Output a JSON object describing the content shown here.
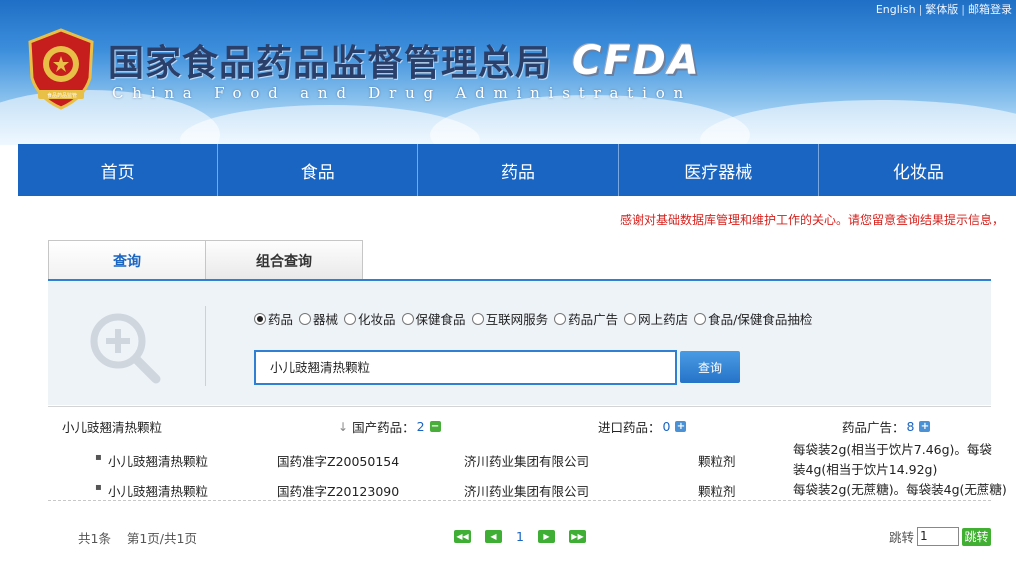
{
  "header": {
    "links": [
      "English",
      "繁体版",
      "邮箱登录"
    ],
    "title_cn": "国家食品药品监督管理总局",
    "title_en": "China Food and Drug Administration",
    "logo_text": "CFDA",
    "emblem_text": "食品药品监管"
  },
  "nav": [
    "首页",
    "食品",
    "药品",
    "医疗器械",
    "化妆品"
  ],
  "notice": "感谢对基础数据库管理和维护工作的关心。请您留意查询结果提示信息，",
  "tabs": [
    "查询",
    "组合查询"
  ],
  "search": {
    "options": [
      "药品",
      "器械",
      "化妆品",
      "保健食品",
      "互联网服务",
      "药品广告",
      "网上药店",
      "食品/保健食品抽检"
    ],
    "selected": "药品",
    "query": "小儿豉翘清热颗粒",
    "button": "查询"
  },
  "summary": {
    "query": "小儿豉翘清热颗粒",
    "domestic_label": "国产药品：",
    "domestic_count": "2",
    "import_label": "进口药品：",
    "import_count": "0",
    "ad_label": "药品广告：",
    "ad_count": "8"
  },
  "results": [
    {
      "name": "小儿豉翘清热颗粒",
      "approval": "国药准字Z20050154",
      "company": "济川药业集团有限公司",
      "form": "颗粒剂",
      "spec": "每袋装2g(相当于饮片7.46g)。每袋装4g(相当于饮片14.92g)"
    },
    {
      "name": "小儿豉翘清热颗粒",
      "approval": "国药准字Z20123090",
      "company": "济川药业集团有限公司",
      "form": "颗粒剂",
      "spec": "每袋装2g(无蔗糖)。每袋装4g(无蔗糖)"
    }
  ],
  "footer": {
    "total": "共1条",
    "page_info": "第1页/共1页",
    "current_page": "1",
    "jump_label": "跳转",
    "jump_value": "1",
    "jump_button": "跳转"
  },
  "colors": {
    "nav_blue": "#1a64c2",
    "accent_blue": "#2f7fd4",
    "notice_red": "#d6201c",
    "pager_green": "#3fae35"
  }
}
